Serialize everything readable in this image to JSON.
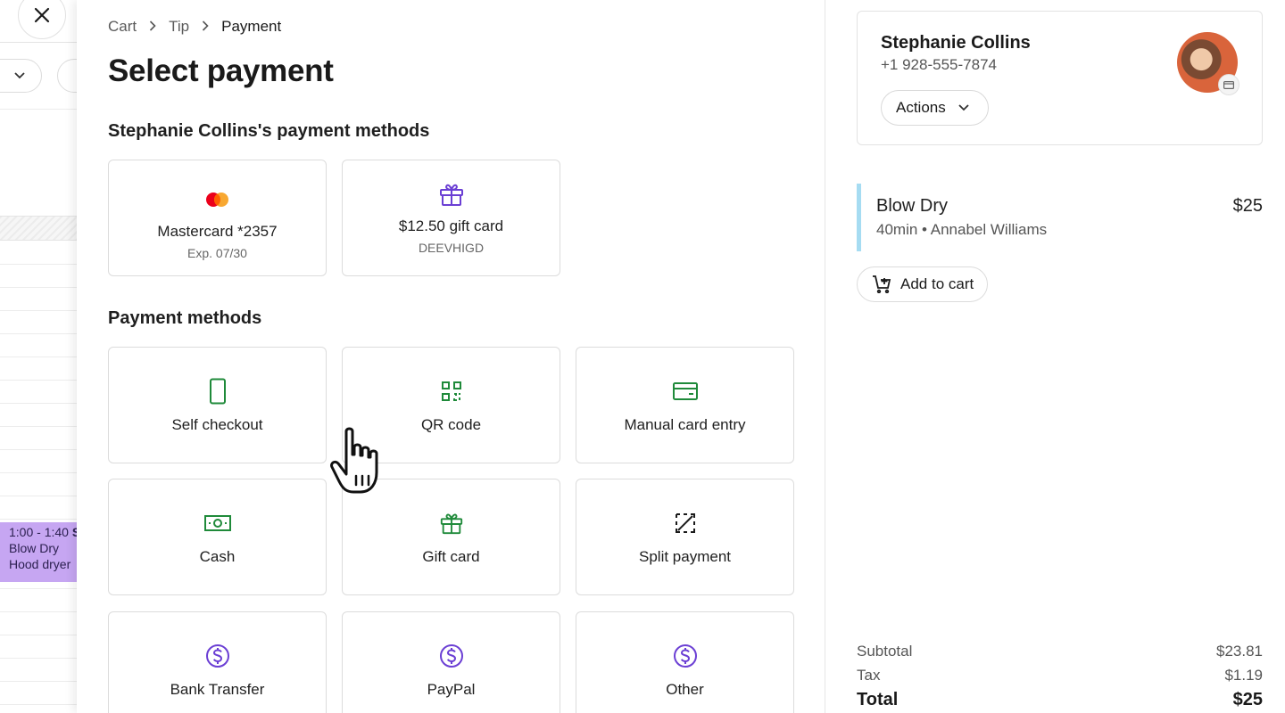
{
  "background": {
    "appointment": {
      "time": "1:00 - 1:40",
      "time_suffix": "S",
      "service": "Blow Dry",
      "resource": "Hood dryer"
    }
  },
  "breadcrumb": {
    "items": [
      "Cart",
      "Tip",
      "Payment"
    ]
  },
  "page_title": "Select payment",
  "client_methods": {
    "heading": "Stephanie Collins's payment methods",
    "cards": [
      {
        "label": "Mastercard *2357",
        "sub": "Exp. 07/30",
        "icon": "mastercard-icon"
      },
      {
        "label": "$12.50 gift card",
        "sub": "DEEVHIGD",
        "icon": "gift-icon"
      }
    ]
  },
  "payment_methods": {
    "heading": "Payment methods",
    "items": [
      {
        "label": "Self checkout",
        "icon": "phone-icon"
      },
      {
        "label": "QR code",
        "icon": "qr-code-icon"
      },
      {
        "label": "Manual card entry",
        "icon": "credit-card-icon"
      },
      {
        "label": "Cash",
        "icon": "cash-icon"
      },
      {
        "label": "Gift card",
        "icon": "gift-icon"
      },
      {
        "label": "Split payment",
        "icon": "split-icon"
      },
      {
        "label": "Bank Transfer",
        "icon": "dollar-icon"
      },
      {
        "label": "PayPal",
        "icon": "dollar-icon"
      },
      {
        "label": "Other",
        "icon": "dollar-icon"
      }
    ]
  },
  "client": {
    "name": "Stephanie Collins",
    "phone": "+1 928-555-7874",
    "actions_label": "Actions"
  },
  "service": {
    "name": "Blow Dry",
    "meta": "40min • Annabel Williams",
    "price": "$25"
  },
  "add_to_cart_label": "Add to cart",
  "summary": {
    "subtotal_label": "Subtotal",
    "subtotal": "$23.81",
    "tax_label": "Tax",
    "tax": "$1.19",
    "total_label": "Total",
    "total": "$25"
  },
  "colors": {
    "icon_purple": "#6b3fd4",
    "icon_green": "#1f8a3a",
    "service_accent": "#a6dcf2",
    "appointment_bg": "#c6a6f2",
    "mastercard_red": "#eb001b",
    "mastercard_orange": "#f79e1b"
  }
}
